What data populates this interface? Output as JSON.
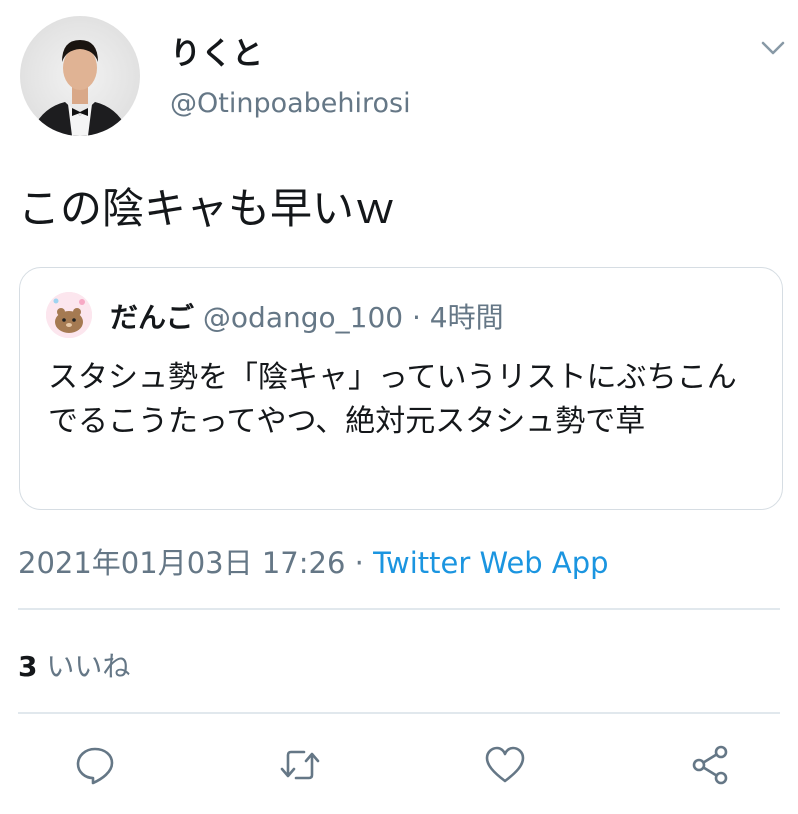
{
  "author": {
    "display_name": "りくと",
    "handle": "@Otinpoabehirosi"
  },
  "tweet": {
    "text": "この陰キャも早いｗ"
  },
  "quoted_tweet": {
    "display_name": "だんご",
    "handle": "@odango_100",
    "time": "· 4時間",
    "text": "スタシュ勢を「陰キャ」っていうリストにぶちこんでるこうたってやつ、絶対元スタシュ勢で草"
  },
  "meta": {
    "timestamp": "2021年01月03日 17:26",
    "separator": " · ",
    "source": "Twitter Web App"
  },
  "stats": {
    "likes_count": "3",
    "likes_label": "いいね"
  },
  "actions": [
    {
      "icon": "reply-icon"
    },
    {
      "icon": "retweet-icon"
    },
    {
      "icon": "like-icon"
    },
    {
      "icon": "share-icon"
    }
  ],
  "colors": {
    "link": "#1b95e0",
    "secondary_text": "#657786",
    "border": "#e1e8ed"
  }
}
